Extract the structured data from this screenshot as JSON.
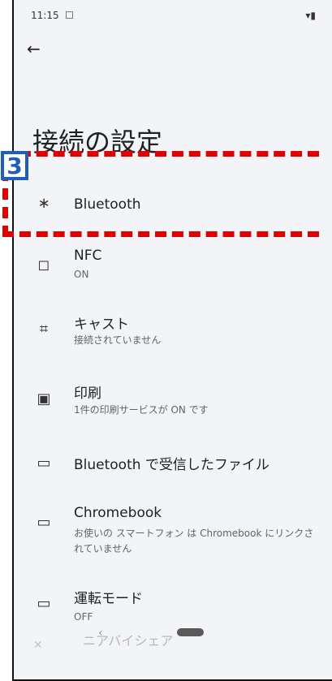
{
  "statusbar": {
    "time": "11:15",
    "icon1": "☐",
    "icons_right": "▾▮"
  },
  "header": {
    "back_icon": "←",
    "title": "接続の設定"
  },
  "annotation": {
    "number": "3"
  },
  "items": [
    {
      "name": "bluetooth",
      "icon": "∗",
      "label": "Bluetooth",
      "sub": ""
    },
    {
      "name": "nfc",
      "icon": "◻",
      "label": "NFC",
      "sub": "ON"
    },
    {
      "name": "cast",
      "icon": "⌗",
      "label": "キャスト",
      "sub": "接続されていません"
    },
    {
      "name": "print",
      "icon": "▣",
      "label": "印刷",
      "sub": "1件の印刷サービスが ON です"
    },
    {
      "name": "received-files",
      "icon": "▭",
      "label": "Bluetooth で受信したファイル",
      "sub": ""
    },
    {
      "name": "chromebook",
      "icon": "▭",
      "label": "Chromebook",
      "sub": "お使いの スマートフォン は Chromebook にリンクされていません"
    },
    {
      "name": "driving-mode",
      "icon": "▭",
      "label": "運転モード",
      "sub": "OFF"
    }
  ],
  "bottom": {
    "text": "ニアバイシェア"
  }
}
